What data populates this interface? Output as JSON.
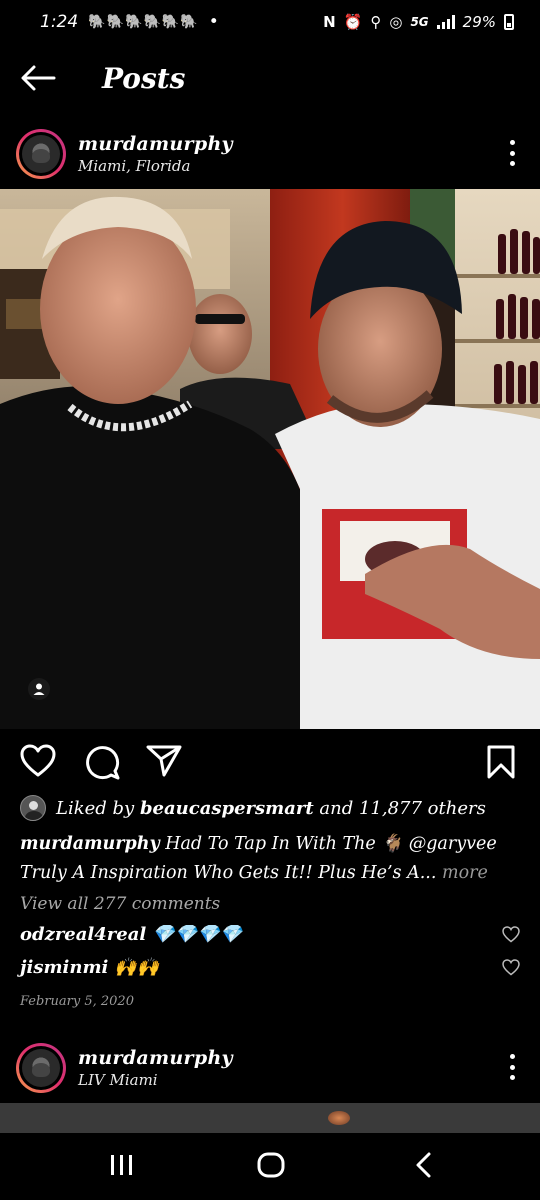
{
  "status_bar": {
    "time": "1:24",
    "notification_icons": "🐘🐘🐘🐘🐘🐘",
    "dot": "•",
    "network": "5G",
    "battery": "29%"
  },
  "header": {
    "title": "Posts"
  },
  "post": {
    "username": "murdamurphy",
    "location": "Miami, Florida",
    "liked_by_prefix": "Liked by",
    "liked_by_user": "beaucaspersmart",
    "liked_by_suffix": "and 11,877 others",
    "caption_user": "murdamurphy",
    "caption_text_1": "Had To Tap In With The 🐐 @garyvee",
    "caption_text_2": "Truly A Inspiration Who Gets It!! Plus He’s A...",
    "caption_more": "more",
    "view_comments": "View all 277 comments",
    "comments": [
      {
        "user": "odzreal4real",
        "text": "💎💎💎💎"
      },
      {
        "user": "jisminmi",
        "text": "🙌🙌"
      }
    ],
    "date": "February 5, 2020"
  },
  "next_post": {
    "username": "murdamurphy",
    "location": "LIV Miami"
  },
  "colors": {
    "background": "#000000",
    "ring_gradient": [
      "#f7a34b",
      "#e1306c",
      "#c13584"
    ],
    "muted_text": "#a8a8a8"
  },
  "icons": {
    "back": "arrow-left-icon",
    "more": "more-vertical-icon",
    "like": "heart-icon",
    "comment": "comment-bubble-icon",
    "share": "paper-plane-icon",
    "save": "bookmark-icon",
    "tag": "user-tag-icon",
    "nav_recents": "recents-icon",
    "nav_home": "home-icon",
    "nav_back": "chevron-left-icon"
  }
}
